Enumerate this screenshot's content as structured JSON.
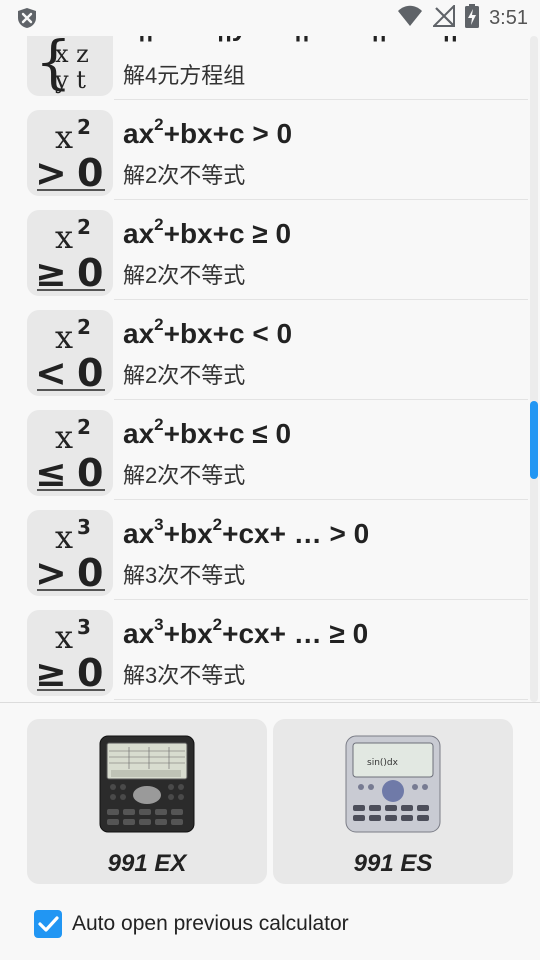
{
  "status": {
    "time": "3:51"
  },
  "rows": [
    {
      "icon": "x-y-z-t-system-icon",
      "formula_html": "a<sub>n</sub>x + b<sub>n</sub>y + c<sub>n</sub>z + d<sub>n</sub>t = e<sub>n</sub>",
      "desc": "解4元方程组"
    },
    {
      "icon": "x2-greater-than-0-icon",
      "power": "2",
      "sign": ">",
      "formula_html": "ax<sup>2</sup>+bx+c &gt; 0",
      "desc": "解2次不等式"
    },
    {
      "icon": "x2-greater-equal-0-icon",
      "power": "2",
      "sign": "≥",
      "formula_html": "ax<sup>2</sup>+bx+c ≥ 0",
      "desc": "解2次不等式"
    },
    {
      "icon": "x2-less-than-0-icon",
      "power": "2",
      "sign": "<",
      "formula_html": "ax<sup>2</sup>+bx+c &lt; 0",
      "desc": "解2次不等式"
    },
    {
      "icon": "x2-less-equal-0-icon",
      "power": "2",
      "sign": "≤",
      "formula_html": "ax<sup>2</sup>+bx+c ≤ 0",
      "desc": "解2次不等式"
    },
    {
      "icon": "x3-greater-than-0-icon",
      "power": "3",
      "sign": ">",
      "formula_html": "ax<sup>3</sup>+bx<sup>2</sup>+cx+ … &gt; 0",
      "desc": "解3次不等式"
    },
    {
      "icon": "x3-greater-equal-0-icon",
      "power": "3",
      "sign": "≥",
      "formula_html": "ax<sup>3</sup>+bx<sup>2</sup>+cx+ … ≥ 0",
      "desc": "解3次不等式"
    }
  ],
  "cards": [
    {
      "title": "991 EX",
      "icon": "calculator-991ex-icon"
    },
    {
      "title": "991 ES",
      "icon": "calculator-991es-icon"
    }
  ],
  "auto_open": {
    "label": "Auto open previous calculator",
    "checked": true
  },
  "scroll": {
    "position_fraction": 0.62
  },
  "colors": {
    "accent": "#2196f3",
    "background": "#f8f8f8",
    "tile": "#e8e8e8"
  }
}
